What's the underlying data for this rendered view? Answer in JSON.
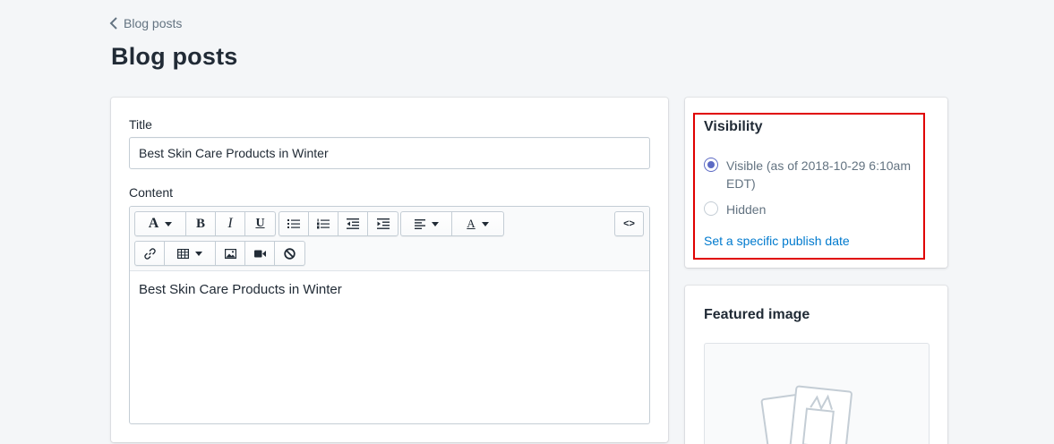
{
  "breadcrumb": {
    "label": "Blog posts"
  },
  "page": {
    "title": "Blog posts"
  },
  "form": {
    "title_label": "Title",
    "title_value": "Best Skin Care Products in Winter",
    "content_label": "Content",
    "content_value": "Best Skin Care Products in Winter"
  },
  "toolbar": {
    "font_label": "A",
    "bold_label": "B",
    "italic_label": "I",
    "underline_label": "U",
    "text_color_label": "A",
    "html_label": "<>"
  },
  "visibility": {
    "title": "Visibility",
    "options": [
      {
        "label": "Visible (as of 2018-10-29 6:10am EDT)",
        "checked": true
      },
      {
        "label": "Hidden",
        "checked": false
      }
    ],
    "publish_link": "Set a specific publish date"
  },
  "featured_image": {
    "title": "Featured image"
  },
  "colors": {
    "accent": "#5c6ac4",
    "link": "#007ace",
    "highlight": "#e00000"
  }
}
